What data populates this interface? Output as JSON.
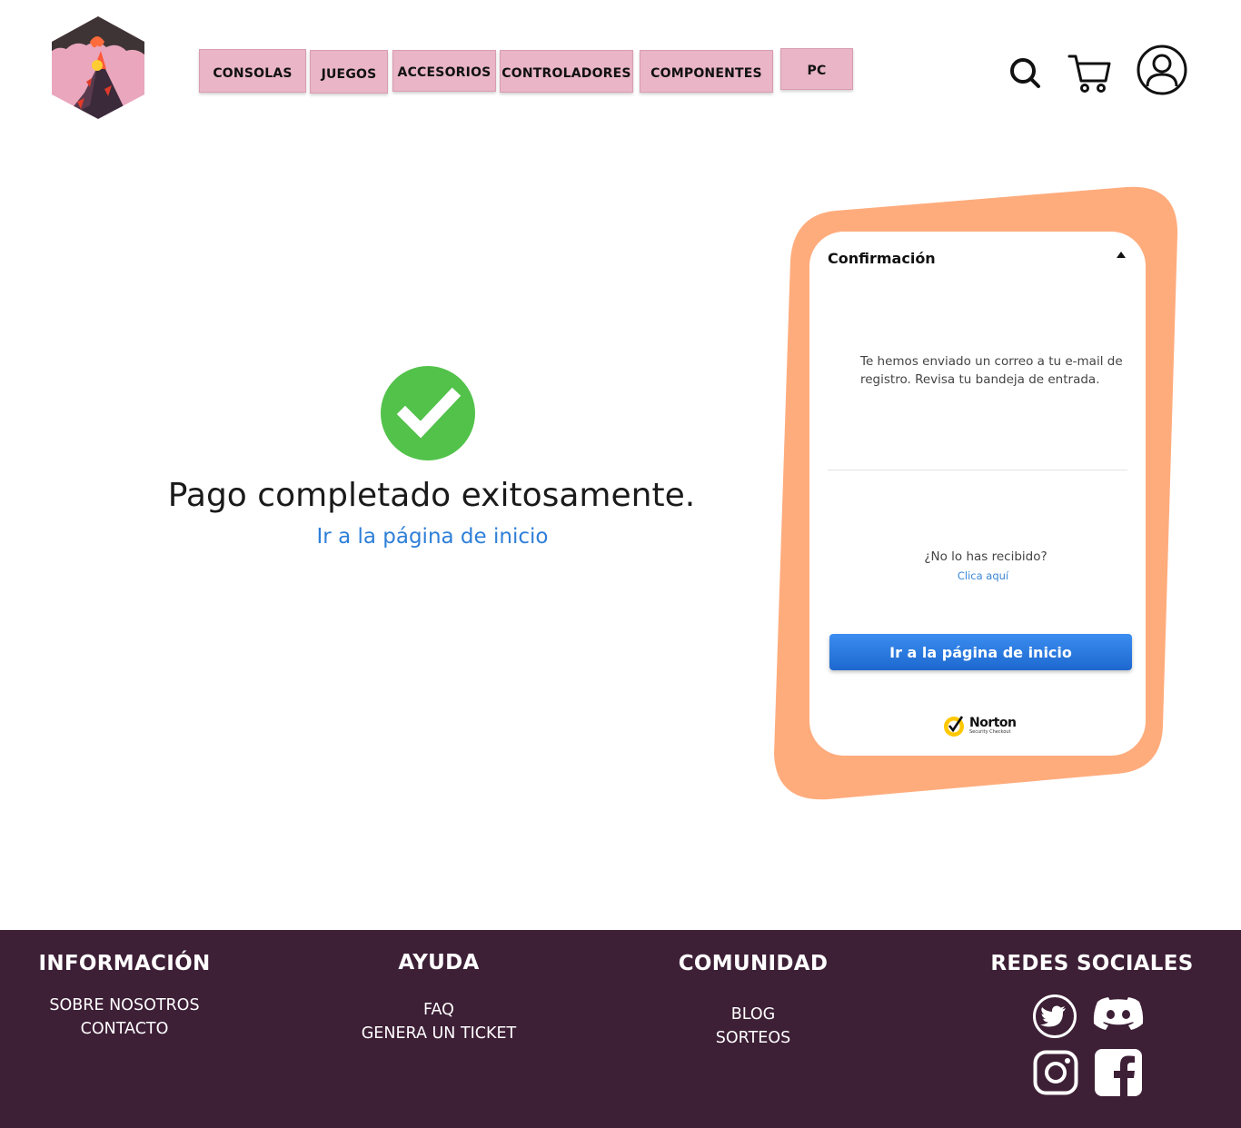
{
  "header": {
    "logo_name": "volcano-logo",
    "nav": [
      "CONSOLAS",
      "JUEGOS",
      "ACCESORIOS",
      "CONTROLADORES",
      "COMPONENTES",
      "PC"
    ]
  },
  "success": {
    "title": "Pago completado exitosamente.",
    "home_link": "Ir a la página de inicio"
  },
  "card": {
    "title": "Confirmación",
    "message": "Te hemos enviado un correo a tu e-mail de registro. Revisa tu bandeja de entrada.",
    "not_received": "¿No lo has recibido?",
    "click_here": "Clica aquí",
    "button": "Ir a la página de inicio",
    "norton_name": "Norton",
    "norton_sub": "Security Checkout"
  },
  "footer": {
    "informacion": {
      "title": "INFORMACIÓN",
      "links": [
        "SOBRE NOSOTROS",
        "CONTACTO"
      ]
    },
    "ayuda": {
      "title": "AYUDA",
      "links": [
        "FAQ",
        "GENERA UN TICKET"
      ]
    },
    "comunidad": {
      "title": "COMUNIDAD",
      "links": [
        "BLOG",
        "SORTEOS"
      ]
    },
    "redes": {
      "title": "REDES SOCIALES"
    }
  },
  "colors": {
    "nav_bg": "#e9b5c7",
    "card_frame": "#ffac7d",
    "success_green": "#52c24a",
    "link_blue": "#2e7fd8",
    "footer_bg": "#3d1f36"
  }
}
